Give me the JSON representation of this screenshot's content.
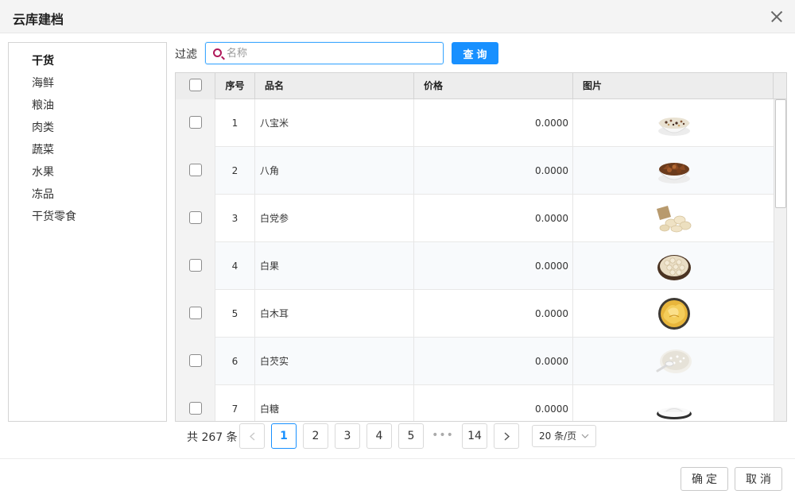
{
  "dialog": {
    "title": "云库建档"
  },
  "categories": [
    {
      "label": "干货",
      "active": true
    },
    {
      "label": "海鲜",
      "active": false
    },
    {
      "label": "粮油",
      "active": false
    },
    {
      "label": "肉类",
      "active": false
    },
    {
      "label": "蔬菜",
      "active": false
    },
    {
      "label": "水果",
      "active": false
    },
    {
      "label": "冻品",
      "active": false
    },
    {
      "label": "干货零食",
      "active": false
    }
  ],
  "filter": {
    "label": "过滤",
    "placeholder": "名称",
    "value": "",
    "query_label": "查询"
  },
  "table": {
    "headers": {
      "seq": "序号",
      "name": "品名",
      "price": "价格",
      "image": "图片"
    },
    "rows": [
      {
        "seq": "1",
        "name": "八宝米",
        "price": "0.0000",
        "image": "mixed-grain-rice-bowl"
      },
      {
        "seq": "2",
        "name": "八角",
        "price": "0.0000",
        "image": "star-anise-bowl"
      },
      {
        "seq": "3",
        "name": "白党参",
        "price": "0.0000",
        "image": "dangshen-root-slices"
      },
      {
        "seq": "4",
        "name": "白果",
        "price": "0.0000",
        "image": "ginkgo-nut-bowl"
      },
      {
        "seq": "5",
        "name": "白木耳",
        "price": "0.0000",
        "image": "white-fungus-bowl"
      },
      {
        "seq": "6",
        "name": "白芡实",
        "price": "0.0000",
        "image": "fox-nut-spoon"
      },
      {
        "seq": "7",
        "name": "白糖",
        "price": "0.0000",
        "image": "white-sugar-plate"
      }
    ]
  },
  "pagination": {
    "total_label": "共 267 条",
    "pages": [
      "1",
      "2",
      "3",
      "4",
      "5"
    ],
    "current": "1",
    "ellipsis": "•••",
    "last": "14",
    "page_size": "20 条/页"
  },
  "footer": {
    "confirm_label": "确定",
    "cancel_label": "取消"
  },
  "colors": {
    "primary": "#1890ff",
    "header_bg": "#ededed",
    "title_bg": "#f4f4f4"
  }
}
